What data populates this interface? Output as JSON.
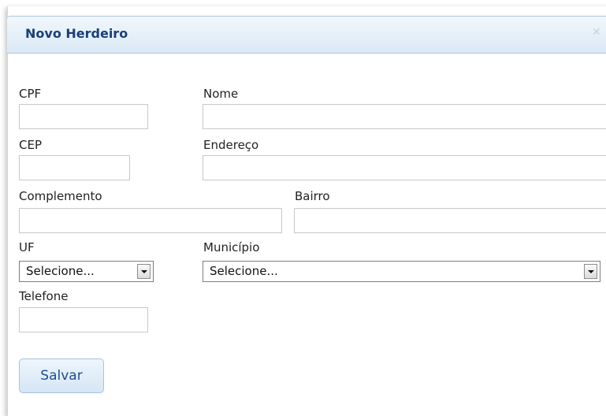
{
  "dialog": {
    "title": "Novo Herdeiro",
    "close_icon": "close-icon"
  },
  "form": {
    "cpf_label": "CPF",
    "nome_label": "Nome",
    "cep_label": "CEP",
    "endereco_label": "Endereço",
    "complemento_label": "Complemento",
    "bairro_label": "Bairro",
    "uf_label": "UF",
    "uf_value": "Selecione...",
    "municipio_label": "Município",
    "municipio_value": "Selecione...",
    "telefone_label": "Telefone",
    "save_label": "Salvar"
  }
}
